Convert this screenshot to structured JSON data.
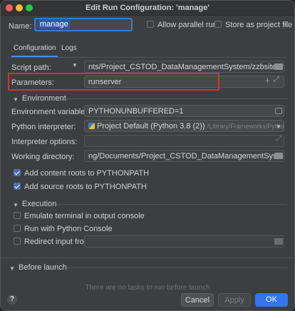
{
  "window": {
    "title": "Edit Run Configuration: 'manage'"
  },
  "header": {
    "name_label": "Name:",
    "name_value": "manage",
    "allow_parallel_label": "Allow parallel run",
    "store_as_project_label": "Store as project file"
  },
  "tabs": [
    {
      "label": "Configuration"
    },
    {
      "label": "Logs"
    }
  ],
  "script": {
    "label": "Script path:",
    "value": "nts/Project_CSTOD_DataManagementSystem/zzbsite/manage.py"
  },
  "parameters": {
    "label": "Parameters:",
    "value": "runserver"
  },
  "environment": {
    "section_label": "Environment",
    "env_vars_label": "Environment variables:",
    "env_vars_value": "PYTHONUNBUFFERED=1",
    "interpreter_label": "Python interpreter:",
    "interpreter_value": "Project Default (Python 3.8 (2))",
    "interpreter_path": "/Library/Frameworks/Python.framewor",
    "interp_options_label": "Interpreter options:",
    "working_dir_label": "Working directory:",
    "working_dir_value": "ng/Documents/Project_CSTOD_DataManagementSystem/zzbsite",
    "add_content_roots_label": "Add content roots to PYTHONPATH",
    "add_source_roots_label": "Add source roots to PYTHONPATH"
  },
  "execution": {
    "section_label": "Execution",
    "emulate_terminal_label": "Emulate terminal in output console",
    "run_python_console_label": "Run with Python Console",
    "redirect_input_label": "Redirect input from:"
  },
  "before_launch": {
    "section_label": "Before launch",
    "empty_text": "There are no tasks to run before launch"
  },
  "footer": {
    "help": "?",
    "cancel": "Cancel",
    "apply": "Apply",
    "ok": "OK"
  },
  "colors": {
    "accent": "#4b6eaf",
    "highlight": "#d9322b",
    "ok_button": "#3574f0"
  }
}
